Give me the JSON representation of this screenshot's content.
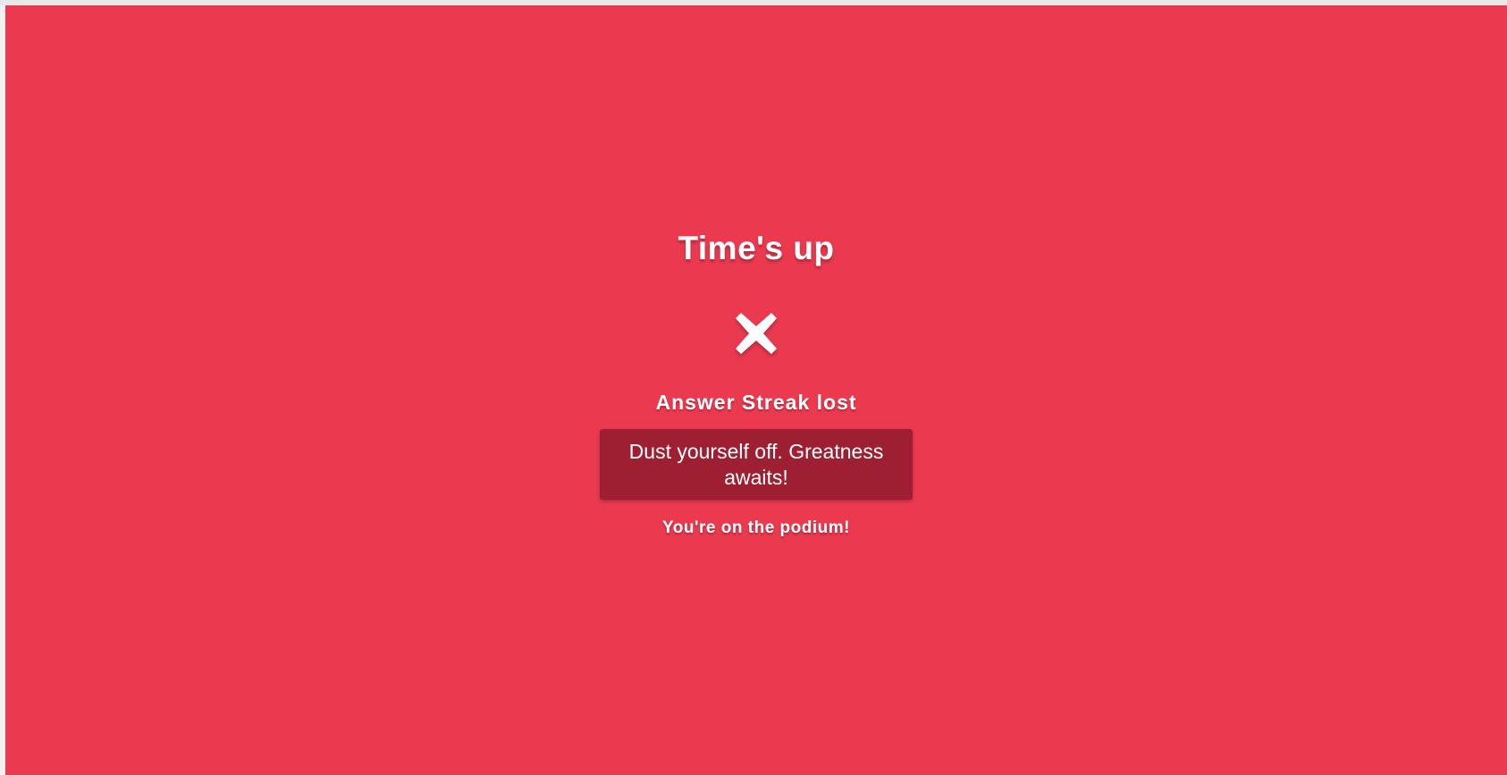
{
  "result": {
    "title": "Time's up",
    "icon": "close-icon",
    "streak_text": "Answer Streak lost",
    "message": "Dust yourself off. Greatness awaits!",
    "rank_text": "You're on the podium!"
  },
  "colors": {
    "background": "#eb3a50",
    "message_box": "#9f1f32",
    "text": "#ffffff"
  }
}
